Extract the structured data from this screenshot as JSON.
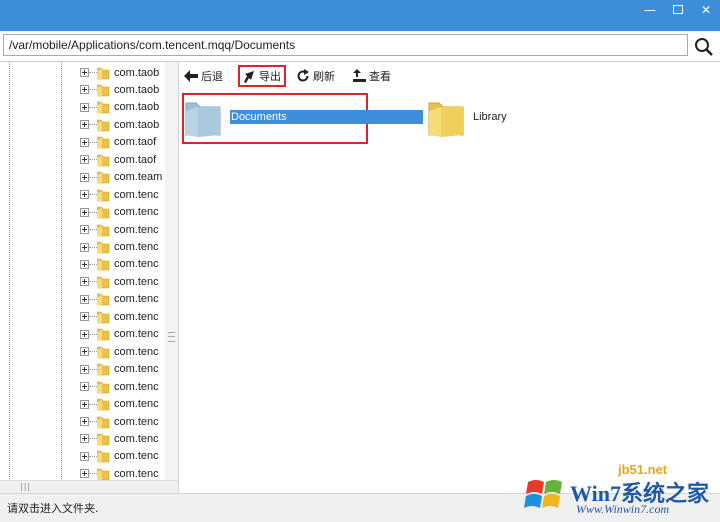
{
  "window": {
    "controls": {
      "minimize": "—",
      "close": "✕"
    }
  },
  "address": {
    "path": "/var/mobile/Applications/com.tencent.mqq/Documents"
  },
  "tree": {
    "items": [
      "com.taob",
      "com.taob",
      "com.taob",
      "com.taob",
      "com.taof",
      "com.taof",
      "com.team",
      "com.tenc",
      "com.tenc",
      "com.tenc",
      "com.tenc",
      "com.tenc",
      "com.tenc",
      "com.tenc",
      "com.tenc",
      "com.tenc",
      "com.tenc",
      "com.tenc",
      "com.tenc",
      "com.tenc",
      "com.tenc",
      "com.tenc",
      "com.tenc",
      "com.tenc"
    ]
  },
  "toolbar": {
    "back": "后退",
    "export": "导出",
    "refresh": "刷新",
    "view": "查看"
  },
  "files": [
    {
      "name": "Documents",
      "selected": true
    },
    {
      "name": "Library",
      "selected": false
    }
  ],
  "status": {
    "text": "请双击进入文件夹."
  },
  "watermark": {
    "domain": "jb51.net",
    "title": "Win7系统之家",
    "url": "Www.Winwin7.com"
  },
  "colors": {
    "titlebar": "#3c8fd8",
    "selection": "#3c8fd8",
    "highlight": "#d9262c"
  }
}
